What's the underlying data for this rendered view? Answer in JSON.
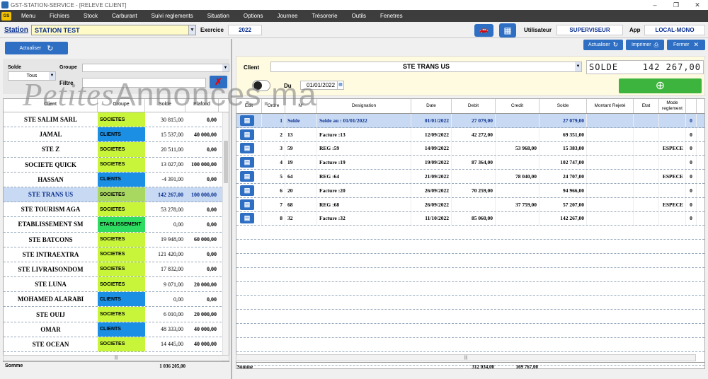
{
  "window": {
    "title": "GST-STATION-SERVICE - [RELEVE CLIENT]"
  },
  "menu": [
    "Menu",
    "Fichiers",
    "Stock",
    "Carburant",
    "Suivi reglements",
    "Situation",
    "Options",
    "Journee",
    "Trésorerie",
    "Outils",
    "Fenetres"
  ],
  "header": {
    "station_label": "Station",
    "station_value": "STATION TEST",
    "exercice_label": "Exercice",
    "exercice_value": "2022",
    "user_label": "Utilisateur",
    "user_value": "SUPERVISEUR",
    "app_label": "App",
    "app_value": "LOCAL-MONO"
  },
  "left": {
    "refresh_label": "Actualiser",
    "solde_label": "Solde",
    "solde_value": "Tous",
    "groupe_label": "Groupe",
    "filtre_label": "Filtre",
    "columns": [
      "Client",
      "Groupe",
      "Solde",
      "Plafond"
    ],
    "rows": [
      {
        "client": "STE SALIM SARL",
        "groupe": "SOCIETES",
        "solde": "30 815,00",
        "plafond": "0,00",
        "gcolor": "#c8f53a"
      },
      {
        "client": "JAMAL",
        "groupe": "CLIENTS",
        "solde": "15 537,00",
        "plafond": "40 000,00",
        "gcolor": "#1a8fe3"
      },
      {
        "client": "STE Z",
        "groupe": "SOCIETES",
        "solde": "20 511,00",
        "plafond": "0,00",
        "gcolor": "#c8f53a"
      },
      {
        "client": "SOCIETE QUICK",
        "groupe": "SOCIETES",
        "solde": "13 027,00",
        "plafond": "100 000,00",
        "gcolor": "#c8f53a"
      },
      {
        "client": "HASSAN",
        "groupe": "CLIENTS",
        "solde": "-4 391,00",
        "plafond": "0,00",
        "gcolor": "#1a8fe3"
      },
      {
        "client": "STE  TRANS US",
        "groupe": "SOCIETES",
        "solde": "142 267,00",
        "plafond": "100 000,00",
        "gcolor": "#a8d860"
      },
      {
        "client": "STE TOURISM AGA",
        "groupe": "SOCIETES",
        "solde": "53 278,00",
        "plafond": "0,00",
        "gcolor": "#c8f53a"
      },
      {
        "client": "ETABLISSEMENT  SM",
        "groupe": "ETABLISSEMENT",
        "solde": "0,00",
        "plafond": "0,00",
        "gcolor": "#2fdc62"
      },
      {
        "client": "STE BATCONS",
        "groupe": "SOCIETES",
        "solde": "19 948,00",
        "plafond": "60 000,00",
        "gcolor": "#c8f53a"
      },
      {
        "client": "STE INTRAEXTRA",
        "groupe": "SOCIETES",
        "solde": "121 420,00",
        "plafond": "0,00",
        "gcolor": "#c8f53a"
      },
      {
        "client": "STE LIVRAISONDOM",
        "groupe": "SOCIETES",
        "solde": "17 832,00",
        "plafond": "0,00",
        "gcolor": "#c8f53a"
      },
      {
        "client": "STE LUNA",
        "groupe": "SOCIETES",
        "solde": "9 071,00",
        "plafond": "20 000,00",
        "gcolor": "#c8f53a"
      },
      {
        "client": "MOHAMED ALARABI",
        "groupe": "CLIENTS",
        "solde": "0,00",
        "plafond": "0,00",
        "gcolor": "#1a8fe3"
      },
      {
        "client": "STE OUIJ",
        "groupe": "SOCIETES",
        "solde": "6 010,00",
        "plafond": "20 000,00",
        "gcolor": "#c8f53a"
      },
      {
        "client": "OMAR",
        "groupe": "CLIENTS",
        "solde": "48 333,00",
        "plafond": "40 000,00",
        "gcolor": "#1a8fe3"
      },
      {
        "client": "STE OCEAN",
        "groupe": "SOCIETES",
        "solde": "14 445,00",
        "plafond": "40 000,00",
        "gcolor": "#c8f53a"
      }
    ],
    "selected_index": 5,
    "footer_label": "Somme",
    "footer_total": "1 036 205,00"
  },
  "right": {
    "refresh_label": "Actualiser",
    "print_label": "Imprimer",
    "close_label": "Fermer",
    "client_label": "Client",
    "client_value": "STE  TRANS US",
    "solde_label": "SOLDE",
    "solde_value": "142 267,00",
    "du_label": "Du",
    "date_value": "01/01/2022",
    "columns": [
      "Edit",
      "Ordre",
      "N°",
      "Designation",
      "Date",
      "Debit",
      "Credit",
      "Solde",
      "Montant Rejeté",
      "Etat",
      "Mode reglement",
      ""
    ],
    "rows": [
      {
        "ordre": "1",
        "n": "Solde",
        "des": "Solde au   :  01/01/2022",
        "date": "01/01/2022",
        "debit": "27 079,00",
        "credit": "",
        "solde": "27 079,00",
        "mode": "",
        "x": "0"
      },
      {
        "ordre": "2",
        "n": "13",
        "des": "Facture :13",
        "date": "12/09/2022",
        "debit": "42 272,00",
        "credit": "",
        "solde": "69 351,00",
        "mode": "",
        "x": "0"
      },
      {
        "ordre": "3",
        "n": "59",
        "des": "REG :59",
        "date": "14/09/2022",
        "debit": "",
        "credit": "53 968,00",
        "solde": "15 383,00",
        "mode": "ESPECE",
        "x": "0"
      },
      {
        "ordre": "4",
        "n": "19",
        "des": "Facture :19",
        "date": "19/09/2022",
        "debit": "87 364,00",
        "credit": "",
        "solde": "102 747,00",
        "mode": "",
        "x": "0"
      },
      {
        "ordre": "5",
        "n": "64",
        "des": "REG :64",
        "date": "21/09/2022",
        "debit": "",
        "credit": "78 040,00",
        "solde": "24 707,00",
        "mode": "ESPECE",
        "x": "0"
      },
      {
        "ordre": "6",
        "n": "20",
        "des": "Facture :20",
        "date": "26/09/2022",
        "debit": "70 259,00",
        "credit": "",
        "solde": "94 966,00",
        "mode": "",
        "x": "0"
      },
      {
        "ordre": "7",
        "n": "68",
        "des": "REG :68",
        "date": "26/09/2022",
        "debit": "",
        "credit": "37 759,00",
        "solde": "57 207,00",
        "mode": "ESPECE",
        "x": "0"
      },
      {
        "ordre": "8",
        "n": "32",
        "des": "Facture :32",
        "date": "11/10/2022",
        "debit": "85 060,00",
        "credit": "",
        "solde": "142 267,00",
        "mode": "",
        "x": "0"
      }
    ],
    "footer_label": "Somme",
    "footer_debit": "312 034,00",
    "footer_credit": "169 767,00"
  },
  "watermark": {
    "part1": "Petites",
    "part2": "Annonces.ma"
  }
}
